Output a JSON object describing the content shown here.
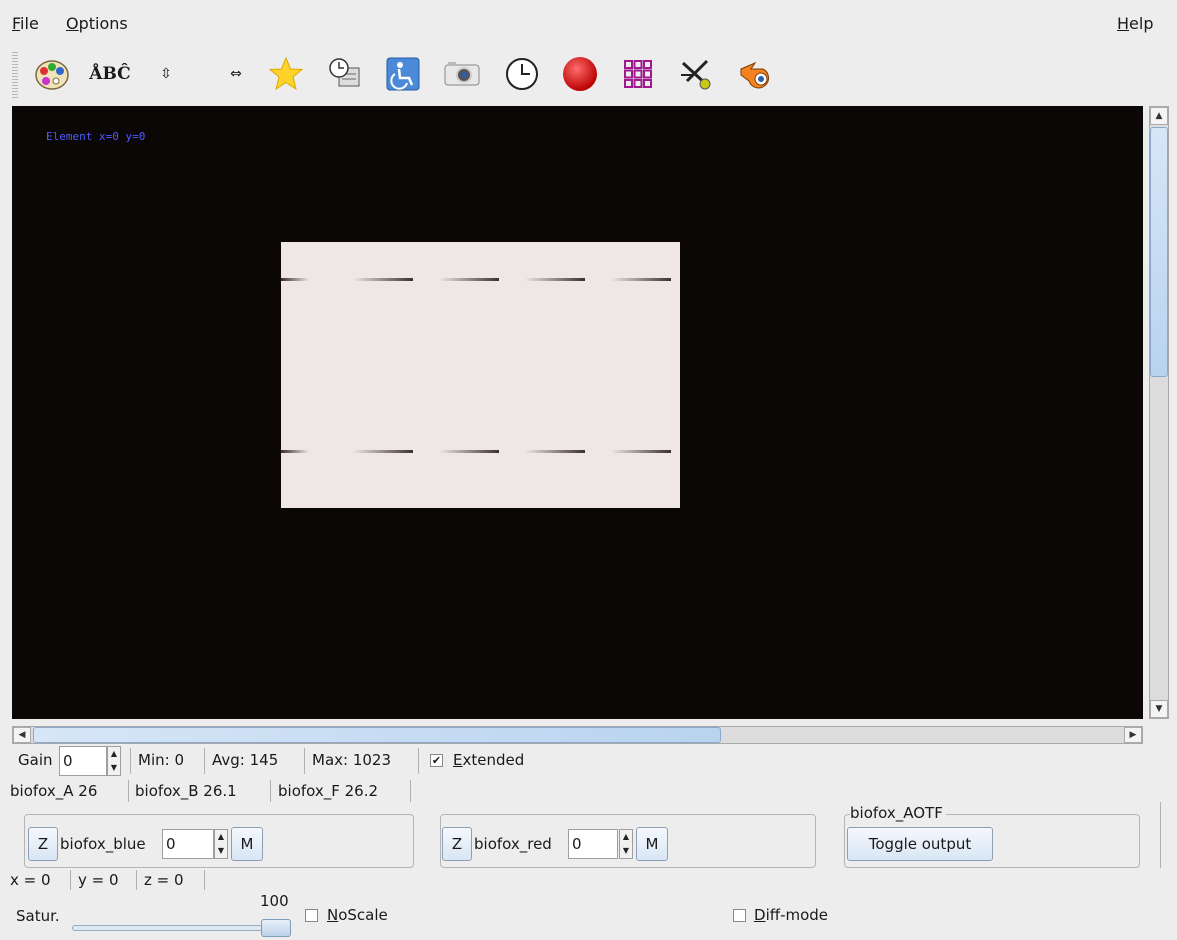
{
  "menubar": {
    "file": "File",
    "options": "Options",
    "help": "Help"
  },
  "toolbar": {
    "icons": [
      "palette-icon",
      "spellcheck-icon",
      "vertical-arrows-icon",
      "horizontal-arrows-icon",
      "star-icon",
      "clock-settings-icon",
      "accessibility-icon",
      "camera-icon",
      "clock-icon",
      "record-icon",
      "grid-icon",
      "compass-icon",
      "blender-icon"
    ],
    "spell_text": "ÅBĈ"
  },
  "viewport": {
    "coord_text": "Element x=0 y=0",
    "background": "#0b0707"
  },
  "controls": {
    "gain_label": "Gain",
    "gain_value": "0",
    "min": "Min: 0",
    "avg": "Avg: 145",
    "max": "Max: 1023",
    "extended_label": "Extended",
    "extended_checked": true,
    "versions": [
      "biofox_A 26",
      "biofox_B 26.1",
      "biofox_F 26.2"
    ],
    "blue": {
      "z": "Z",
      "label": "biofox_blue",
      "value": "0",
      "m": "M"
    },
    "red": {
      "z": "Z",
      "label": "biofox_red",
      "value": "0",
      "m": "M"
    },
    "aotf": {
      "title": "biofox_AOTF",
      "button": "Toggle output"
    },
    "xyz": [
      "x = 0",
      "y = 0",
      "z = 0"
    ],
    "satur_label": "Satur.",
    "satur_value": "100",
    "noscale_label": "NoScale",
    "diff_label": "Diff-mode"
  }
}
